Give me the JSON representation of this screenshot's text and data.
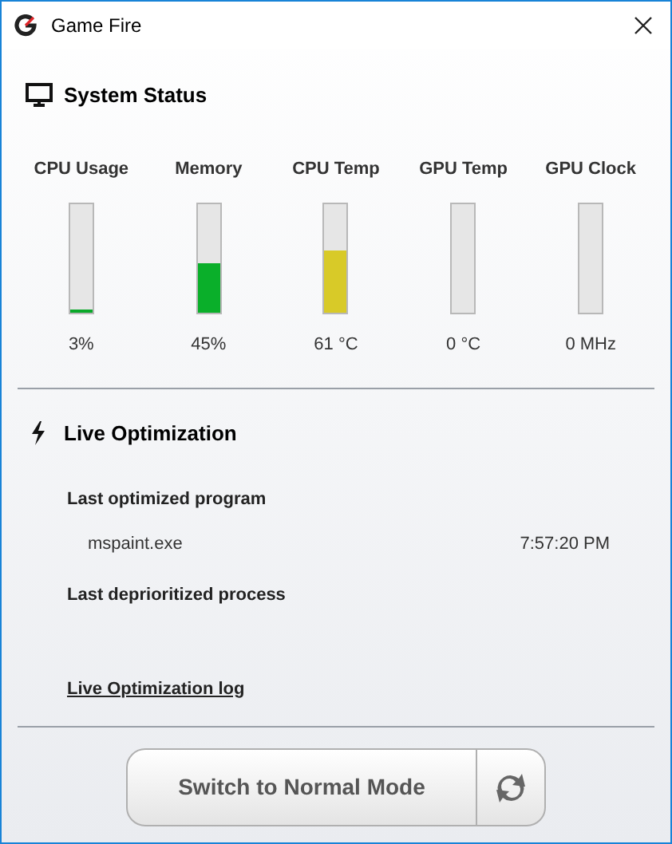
{
  "window": {
    "title": "Game Fire"
  },
  "system_status": {
    "title": "System Status",
    "meters": [
      {
        "label": "CPU Usage",
        "level": 0.03,
        "color": "#0aa82a",
        "reading": "3%"
      },
      {
        "label": "Memory",
        "level": 0.45,
        "color": "#0aaf2a",
        "reading": "45%"
      },
      {
        "label": "CPU Temp",
        "level": 0.58,
        "color": "#d8ca28",
        "reading": "61 °C"
      },
      {
        "label": "GPU Temp",
        "reading": "0 °C"
      },
      {
        "label": "GPU Clock",
        "reading": "0 MHz"
      }
    ]
  },
  "live_optimization": {
    "title": "Live Optimization",
    "last_optimized_label": "Last optimized program",
    "last_optimized": {
      "program": "mspaint.exe",
      "time": "7:57:20 PM"
    },
    "last_deprioritized_label": "Last deprioritized process",
    "log_link": "Live Optimization log"
  },
  "mode_button": {
    "label": "Switch to Normal Mode"
  }
}
